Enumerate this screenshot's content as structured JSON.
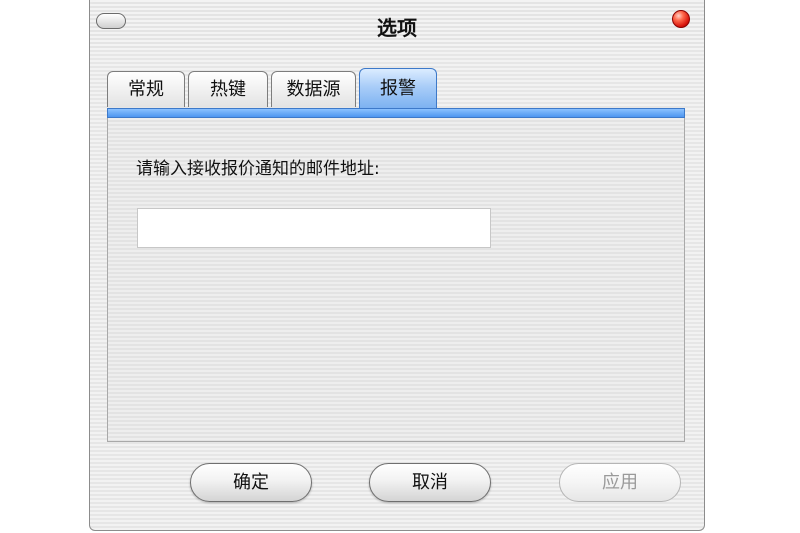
{
  "window": {
    "title": "选项"
  },
  "tabs": [
    {
      "label": "常规"
    },
    {
      "label": "热键"
    },
    {
      "label": "数据源"
    },
    {
      "label": "报警"
    }
  ],
  "active_tab": "报警",
  "alert_panel": {
    "prompt": "请输入接收报价通知的邮件地址:",
    "email_value": ""
  },
  "buttons": {
    "ok": "确定",
    "cancel": "取消",
    "apply": "应用"
  },
  "colors": {
    "active_tab": "#7db2f1",
    "close_button": "#d8140c"
  },
  "icons": {
    "window_control": "pill-icon",
    "close": "close-icon"
  }
}
